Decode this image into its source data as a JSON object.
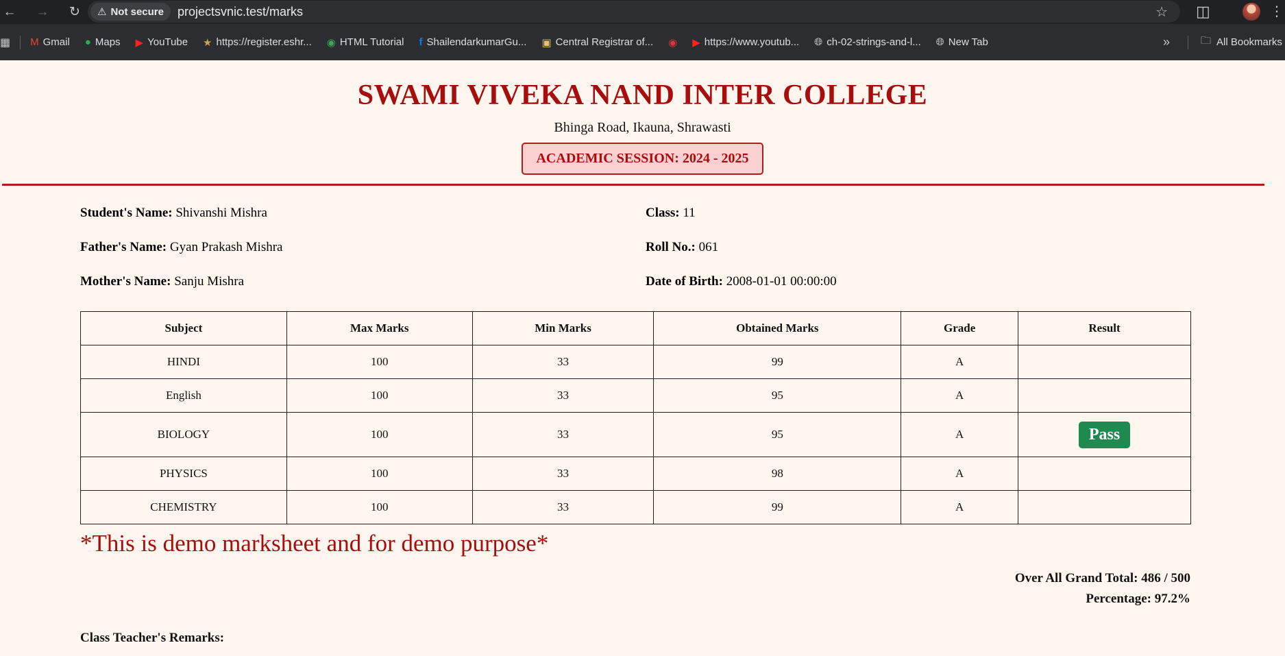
{
  "browser": {
    "security_label": "Not secure",
    "url": "projectsvnic.test/marks",
    "bookmarks": [
      {
        "label": "Gmail",
        "icon": "gmail-icon"
      },
      {
        "label": "Maps",
        "icon": "maps-icon"
      },
      {
        "label": "YouTube",
        "icon": "youtube-icon"
      },
      {
        "label": "https://register.eshr...",
        "icon": "emblem-icon"
      },
      {
        "label": "HTML Tutorial",
        "icon": "html-tutorial-icon"
      },
      {
        "label": "ShailendarkumarGu...",
        "icon": "facebook-icon"
      },
      {
        "label": "Central Registrar of...",
        "icon": "registrar-icon"
      },
      {
        "label": "",
        "icon": "flag-icon"
      },
      {
        "label": "https://www.youtub...",
        "icon": "youtube-icon"
      },
      {
        "label": "ch-02-strings-and-l...",
        "icon": "globe-icon"
      },
      {
        "label": "New Tab",
        "icon": "globe-icon"
      }
    ],
    "all_bookmarks_label": "All Bookmarks"
  },
  "header": {
    "college_name": "SWAMI VIVEKA NAND INTER COLLEGE",
    "address": "Bhinga Road, Ikauna, Shrawasti",
    "session": "ACADEMIC SESSION: 2024 - 2025"
  },
  "student": {
    "name_label": "Student's Name:",
    "name": "Shivanshi Mishra",
    "father_label": "Father's Name:",
    "father": "Gyan Prakash Mishra",
    "mother_label": "Mother's Name:",
    "mother": "Sanju Mishra",
    "class_label": "Class:",
    "class": "11",
    "roll_label": "Roll No.:",
    "roll": "061",
    "dob_label": "Date of Birth:",
    "dob": "2008-01-01 00:00:00"
  },
  "table": {
    "headers": [
      "Subject",
      "Max Marks",
      "Min Marks",
      "Obtained Marks",
      "Grade",
      "Result"
    ],
    "rows": [
      {
        "subject": "HINDI",
        "max": "100",
        "min": "33",
        "obtained": "99",
        "grade": "A"
      },
      {
        "subject": "English",
        "max": "100",
        "min": "33",
        "obtained": "95",
        "grade": "A"
      },
      {
        "subject": "BIOLOGY",
        "max": "100",
        "min": "33",
        "obtained": "95",
        "grade": "A"
      },
      {
        "subject": "PHYSICS",
        "max": "100",
        "min": "33",
        "obtained": "98",
        "grade": "A"
      },
      {
        "subject": "CHEMISTRY",
        "max": "100",
        "min": "33",
        "obtained": "99",
        "grade": "A"
      }
    ],
    "result": "Pass"
  },
  "demo_note": "*This is demo marksheet and for demo purpose*",
  "totals": {
    "grand_total_label": "Over All Grand Total:",
    "grand_total": "486 / 500",
    "percentage_label": "Percentage:",
    "percentage": "97.2%"
  },
  "remarks_label": "Class Teacher's Remarks:",
  "colors": {
    "accent": "#a80d0d",
    "session_bg": "#fbd0d0",
    "pass_green": "#1e8a4f",
    "page_bg": "#fff7ef"
  }
}
